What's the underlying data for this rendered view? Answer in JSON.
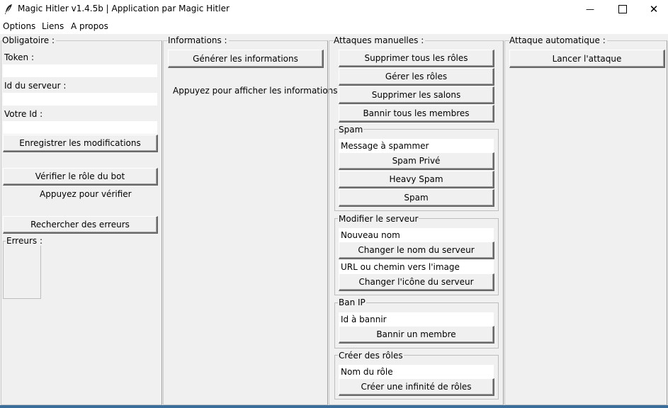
{
  "window": {
    "title": "Magic Hitler v1.4.5b | Application par Magic Hitler",
    "minimize_glyph": "—",
    "maximize_glyph": "☐",
    "close_glyph": "✕",
    "icon": "feather-icon"
  },
  "menu": {
    "options": "Options",
    "liens": "Liens",
    "apropos": "A propos"
  },
  "obligatoire": {
    "title": "Obligatoire :",
    "token_label": "Token :",
    "token_value": "",
    "server_id_label": "Id du serveur :",
    "server_id_value": "",
    "user_id_label": "Votre Id :",
    "user_id_value": "",
    "save_button": "Enregistrer les modifications",
    "check_role_button": "Vérifier le rôle du bot",
    "check_role_status": "Appuyez pour vérifier",
    "search_errors_button": "Rechercher des erreurs",
    "errors_label": "Erreurs :"
  },
  "informations": {
    "title": "Informations :",
    "generate_button": "Générer les informations",
    "status_text": "Appuyez pour afficher les informations"
  },
  "manual": {
    "title": "Attaques manuelles :",
    "delete_roles_button": "Supprimer tous les rôles",
    "manage_roles_button": "Gérer les rôles",
    "delete_channels_button": "Supprimer les salons",
    "ban_all_button": "Bannir tous les membres",
    "spam": {
      "label": "Spam",
      "message_value": "Message à spammer",
      "private_button": "Spam Privé",
      "heavy_button": "Heavy Spam",
      "spam_button": "Spam"
    },
    "modify_server": {
      "label": "Modifier le serveur",
      "name_value": "Nouveau nom",
      "change_name_button": "Changer le nom du serveur",
      "icon_value": "URL ou chemin vers l'image",
      "change_icon_button": "Changer l'icône du serveur"
    },
    "ban_ip": {
      "label": "Ban IP",
      "id_value": "Id à bannir",
      "ban_button": "Bannir un membre"
    },
    "create_roles": {
      "label": "Créer des rôles",
      "name_value": "Nom du rôle",
      "create_button": "Créer une infinité de rôles"
    }
  },
  "auto": {
    "title": "Attaque automatique :",
    "launch_button": "Lancer l'attaque"
  }
}
